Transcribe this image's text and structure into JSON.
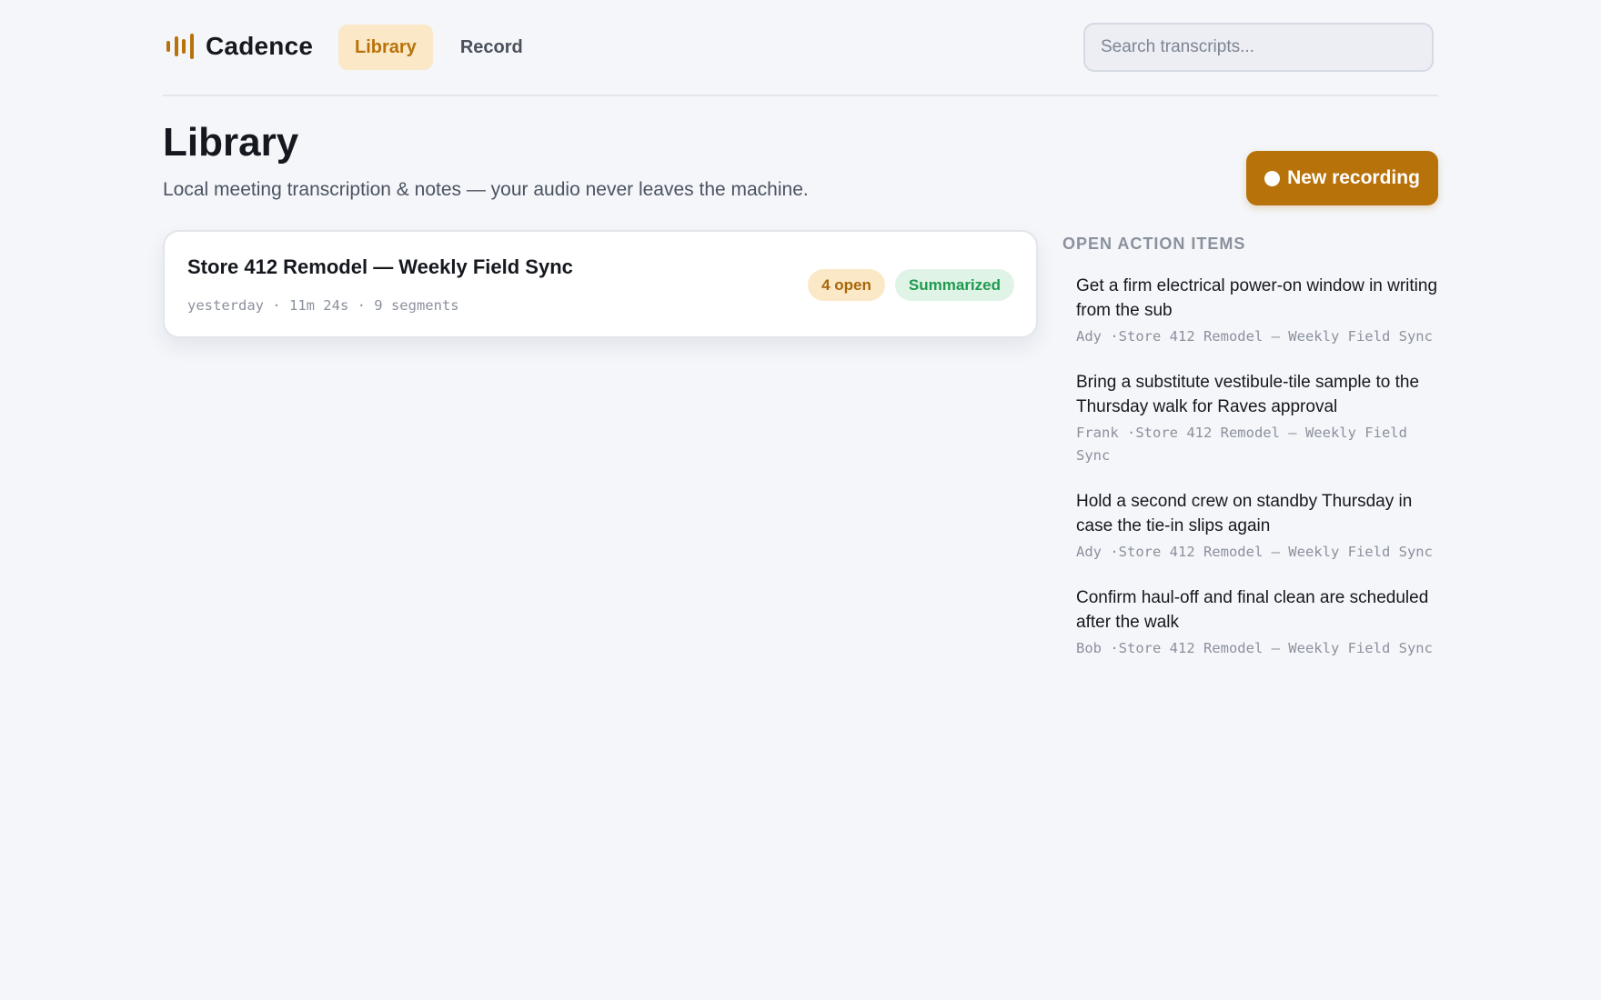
{
  "app": {
    "name": "Cadence",
    "logo_icon": "waveform-icon",
    "accent_color": "#b8720a"
  },
  "nav": {
    "tabs": [
      {
        "label": "Library",
        "active": true
      },
      {
        "label": "Record",
        "active": false
      }
    ]
  },
  "search": {
    "placeholder": "Search transcripts...",
    "value": ""
  },
  "page": {
    "title": "Library",
    "subtitle": "Local meeting transcription & notes — your audio never leaves the machine."
  },
  "new_recording": {
    "label": "New recording",
    "icon": "record-dot-icon"
  },
  "transcripts": [
    {
      "title": "Store 412 Remodel — Weekly Field Sync",
      "meta": "yesterday · 11m 24s · 9 segments",
      "open_badge": "4 open",
      "status_badge": "Summarized"
    }
  ],
  "action_items": {
    "heading": "Open action items",
    "items": [
      {
        "text": "Get a firm electrical power-on window in writing from the sub",
        "meta": "Ady ·Store 412 Remodel — Weekly Field Sync"
      },
      {
        "text": "Bring a substitute vestibule-tile sample to the Thursday walk for Raves approval",
        "meta": "Frank ·Store 412 Remodel — Weekly Field Sync"
      },
      {
        "text": "Hold a second crew on standby Thursday in case the tie-in slips again",
        "meta": "Ady ·Store 412 Remodel — Weekly Field Sync"
      },
      {
        "text": "Confirm haul-off and final clean are scheduled after the walk",
        "meta": "Bob ·Store 412 Remodel — Weekly Field Sync"
      }
    ]
  }
}
